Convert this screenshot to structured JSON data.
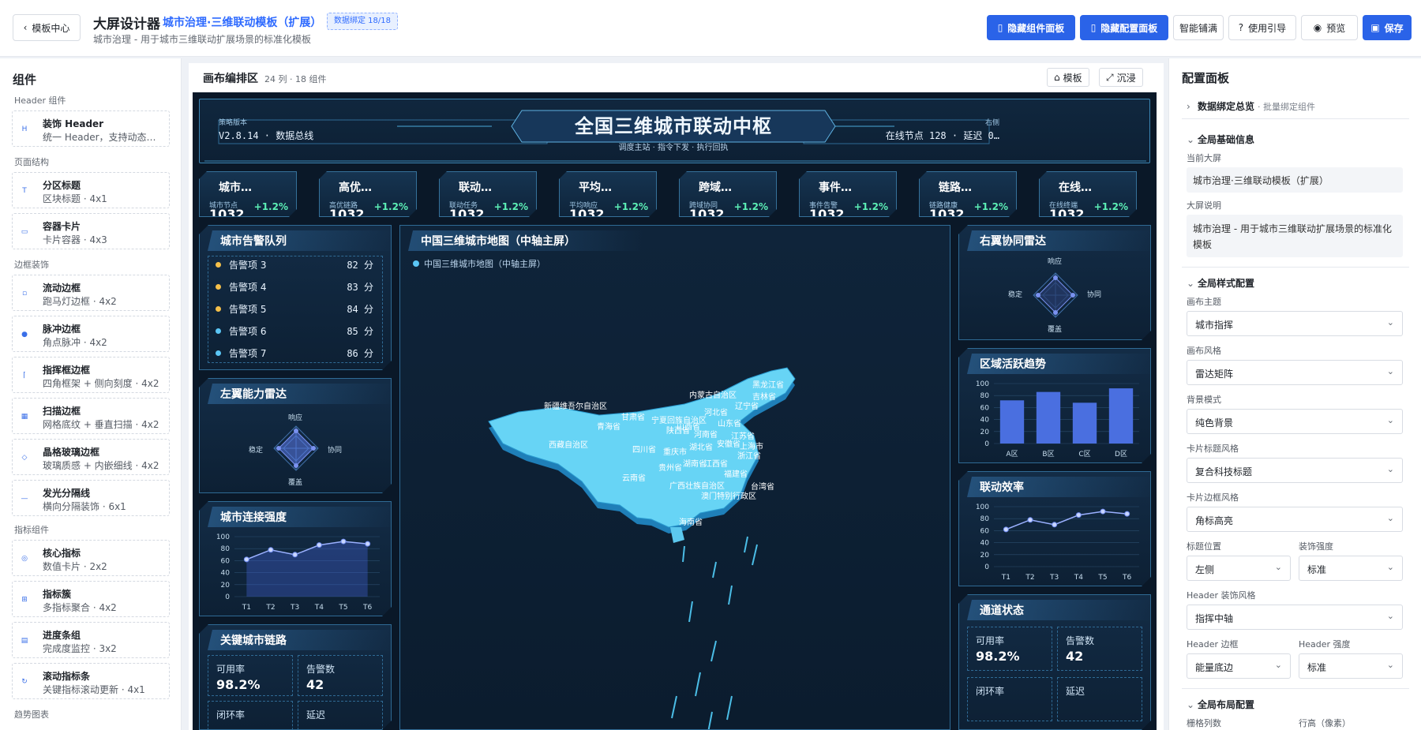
{
  "topbar": {
    "back_label": "模板中心",
    "app_title": "大屏设计器",
    "template_name": "城市治理·三维联动模板（扩展）",
    "binding_badge": "数据绑定 18/18",
    "subtitle": "城市治理 - 用于城市三维联动扩展场景的标准化模板",
    "buttons": {
      "hide_components": "隐藏组件面板",
      "hide_config": "隐藏配置面板",
      "smart_layout": "智能铺满",
      "guide": "使用引导",
      "preview": "预览",
      "save": "保存"
    }
  },
  "left_panel": {
    "title": "组件",
    "groups": [
      {
        "label": "Header 组件",
        "items": [
          {
            "icon": "H",
            "name": "装饰 Header",
            "desc": "统一 Header，支持动态切换样式"
          }
        ]
      },
      {
        "label": "页面结构",
        "items": [
          {
            "icon": "T",
            "name": "分区标题",
            "desc": "区块标题 · 4x1"
          },
          {
            "icon": "▭",
            "name": "容器卡片",
            "desc": "卡片容器 · 4x3"
          }
        ]
      },
      {
        "label": "边框装饰",
        "items": [
          {
            "icon": "▫",
            "name": "流动边框",
            "desc": "跑马灯边框 · 4x2"
          },
          {
            "icon": "●",
            "name": "脉冲边框",
            "desc": "角点脉冲 · 4x2"
          },
          {
            "icon": "⌈",
            "name": "指挥框边框",
            "desc": "四角框架 + 侧向刻度 · 4x2"
          },
          {
            "icon": "▦",
            "name": "扫描边框",
            "desc": "网格底纹 + 垂直扫描 · 4x2"
          },
          {
            "icon": "◇",
            "name": "晶格玻璃边框",
            "desc": "玻璃质感 + 内嵌细线 · 4x2"
          },
          {
            "icon": "—",
            "name": "发光分隔线",
            "desc": "横向分隔装饰 · 6x1"
          }
        ]
      },
      {
        "label": "指标组件",
        "items": [
          {
            "icon": "◎",
            "name": "核心指标",
            "desc": "数值卡片 · 2x2"
          },
          {
            "icon": "⊞",
            "name": "指标簇",
            "desc": "多指标聚合 · 4x2"
          },
          {
            "icon": "▤",
            "name": "进度条组",
            "desc": "完成度监控 · 3x2"
          },
          {
            "icon": "↻",
            "name": "滚动指标条",
            "desc": "关键指标滚动更新 · 4x1"
          }
        ]
      },
      {
        "label": "趋势图表",
        "items": []
      }
    ]
  },
  "canvas": {
    "title": "画布编排区",
    "meta": "24 列 · 18 组件",
    "template_btn": "模板",
    "immersive_btn": "沉浸",
    "header": {
      "left_label": "策略版本",
      "left_value": "V2.8.14 · 数据总线",
      "title": "全国三维城市联动中枢",
      "subtitle": "调度主站 · 指令下发 · 执行回执",
      "right_label": "右侧",
      "right_value": "在线节点 128 · 延迟 0…"
    },
    "kpis": [
      {
        "title": "城市…",
        "label": "城市节点",
        "value": "1032",
        "delta": "+1.2%"
      },
      {
        "title": "高优…",
        "label": "高优链路",
        "value": "1032",
        "delta": "+1.2%"
      },
      {
        "title": "联动…",
        "label": "联动任务",
        "value": "1032",
        "delta": "+1.2%"
      },
      {
        "title": "平均…",
        "label": "平均响应",
        "value": "1032",
        "delta": "+1.2%"
      },
      {
        "title": "跨域…",
        "label": "跨域协同",
        "value": "1032",
        "delta": "+1.2%"
      },
      {
        "title": "事件…",
        "label": "事件告警",
        "value": "1032",
        "delta": "+1.2%"
      },
      {
        "title": "链路…",
        "label": "链路健康",
        "value": "1032",
        "delta": "+1.2%"
      },
      {
        "title": "在线…",
        "label": "在线终端",
        "value": "1032",
        "delta": "+1.2%"
      }
    ],
    "alarm_card": {
      "title": "城市告警队列",
      "items": [
        {
          "name": "告警项 3",
          "score": "82 分",
          "color": "#f5c04a"
        },
        {
          "name": "告警项 4",
          "score": "83 分",
          "color": "#f5c04a"
        },
        {
          "name": "告警项 5",
          "score": "84 分",
          "color": "#f5c04a"
        },
        {
          "name": "告警项 6",
          "score": "85 分",
          "color": "#5bc6f5"
        },
        {
          "name": "告警项 7",
          "score": "86 分",
          "color": "#5bc6f5"
        }
      ]
    },
    "left_radar": {
      "title": "左翼能力雷达",
      "top": "响应",
      "left": "稳定",
      "right": "协同",
      "bottom": "覆盖"
    },
    "right_radar": {
      "title": "右翼协同雷达",
      "top": "响应",
      "left": "稳定",
      "right": "协同",
      "bottom": "覆盖"
    },
    "link_strength": {
      "title": "城市连接强度"
    },
    "key_links": {
      "title": "关键城市链路",
      "stats": [
        {
          "label": "可用率",
          "value": "98.2%"
        },
        {
          "label": "告警数",
          "value": "42"
        },
        {
          "label": "闭环率",
          "value": ""
        },
        {
          "label": "延迟",
          "value": ""
        }
      ]
    },
    "map": {
      "title": "中国三维城市地图（中轴主屏）",
      "legend": "中国三维城市地图（中轴主屏）",
      "provinces": [
        "新疆维吾尔自治区",
        "西藏自治区",
        "青海省",
        "甘肃省",
        "内蒙古自治区",
        "黑龙江省",
        "吉林省",
        "辽宁省",
        "河北省",
        "山西省",
        "陕西省",
        "宁夏回族自治区",
        "河南省",
        "山东省",
        "江苏省",
        "安徽省",
        "湖北省",
        "四川省",
        "重庆市",
        "上海市",
        "浙江省",
        "江西省",
        "湖南省",
        "贵州省",
        "云南省",
        "广西壮族自治区",
        "福建省",
        "台湾省",
        "澳门特别行政区",
        "海南省"
      ]
    },
    "region_activity": {
      "title": "区域活跃趋势"
    },
    "linkage_efficiency": {
      "title": "联动效率"
    },
    "channel_status": {
      "title": "通道状态",
      "stats": [
        {
          "label": "可用率",
          "value": "98.2%"
        },
        {
          "label": "告警数",
          "value": "42"
        },
        {
          "label": "闭环率",
          "value": ""
        },
        {
          "label": "延迟",
          "value": ""
        }
      ]
    }
  },
  "chart_data": [
    {
      "type": "line",
      "x": [
        "T1",
        "T2",
        "T3",
        "T4",
        "T5",
        "T6"
      ],
      "values": [
        62,
        78,
        70,
        86,
        92,
        88
      ],
      "ylim": [
        0,
        100
      ],
      "yticks": [
        0,
        20,
        40,
        60,
        80,
        100
      ]
    },
    {
      "type": "bar",
      "categories": [
        "A区",
        "B区",
        "C区",
        "D区"
      ],
      "values": [
        72,
        86,
        68,
        92
      ],
      "ylim": [
        0,
        100
      ],
      "yticks": [
        0,
        20,
        40,
        60,
        80,
        100
      ]
    },
    {
      "type": "line",
      "x": [
        "T1",
        "T2",
        "T3",
        "T4",
        "T5",
        "T6"
      ],
      "values": [
        62,
        78,
        70,
        86,
        92,
        88
      ],
      "ylim": [
        0,
        100
      ],
      "yticks": [
        0,
        20,
        40,
        60,
        80,
        100
      ]
    }
  ],
  "right_panel": {
    "title": "配置面板",
    "binding_overview": "数据绑定总览",
    "binding_hint": "· 批量绑定组件",
    "base_info": "全局基础信息",
    "current_screen_label": "当前大屏",
    "current_screen_value": "城市治理·三维联动模板（扩展）",
    "screen_desc_label": "大屏说明",
    "screen_desc_value": "城市治理 - 用于城市三维联动扩展场景的标准化模板",
    "style_config": "全局样式配置",
    "theme_label": "画布主题",
    "theme_value": "城市指挥",
    "style_label": "画布风格",
    "style_value": "雷达矩阵",
    "bg_label": "背景模式",
    "bg_value": "纯色背景",
    "card_title_label": "卡片标题风格",
    "card_title_value": "复合科技标题",
    "card_border_label": "卡片边框风格",
    "card_border_value": "角标高亮",
    "title_pos_label": "标题位置",
    "title_pos_value": "左侧",
    "deco_label": "装饰强度",
    "deco_value": "标准",
    "header_style_label": "Header 装饰风格",
    "header_style_value": "指挥中轴",
    "header_border_label": "Header 边框",
    "header_border_value": "能量底边",
    "header_strength_label": "Header 强度",
    "header_strength_value": "标准",
    "layout_config": "全局布局配置",
    "grid_cols_label": "栅格列数",
    "row_height_label": "行高（像素）"
  },
  "colors": {
    "primary": "#2a63e8",
    "screen_bg": "#0a1828",
    "accent": "#5cf0b6",
    "bar": "#4a6fe0"
  }
}
